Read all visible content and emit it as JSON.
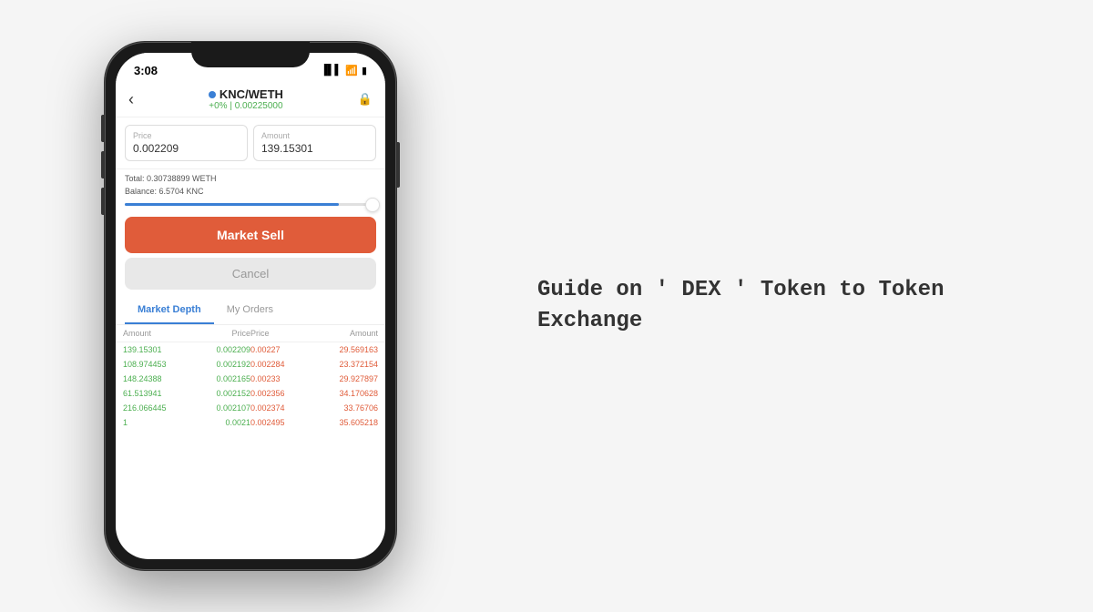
{
  "page": {
    "background": "#f5f5f5"
  },
  "status_bar": {
    "time": "3:08",
    "signal": "▐▌▌",
    "wifi": "WiFi",
    "battery": "🔋"
  },
  "header": {
    "back_label": "‹",
    "pair": "KNC/WETH",
    "change": "+0% | 0.00225000",
    "lock_icon": "🔒"
  },
  "price_input": {
    "label": "Price",
    "value": "0.002209"
  },
  "amount_input": {
    "label": "Amount",
    "value": "139.15301"
  },
  "total_info": {
    "total": "Total: 0.30738899 WETH",
    "balance": "Balance: 6.5704 KNC"
  },
  "buttons": {
    "sell": "Market Sell",
    "cancel": "Cancel"
  },
  "tabs": {
    "market_depth": "Market Depth",
    "my_orders": "My Orders"
  },
  "depth_header": {
    "amount_left": "Amount",
    "price_left": "Price",
    "price_right": "Price",
    "amount_right": "Amount"
  },
  "depth_rows": [
    {
      "amount_left": "139.15301",
      "price_left": "0.002209",
      "price_right": "0.00227",
      "amount_right": "29.569163"
    },
    {
      "amount_left": "108.974453",
      "price_left": "0.002192",
      "price_right": "0.002284",
      "amount_right": "23.372154"
    },
    {
      "amount_left": "148.24388",
      "price_left": "0.002165",
      "price_right": "0.00233",
      "amount_right": "29.927897"
    },
    {
      "amount_left": "61.513941",
      "price_left": "0.002152",
      "price_right": "0.002356",
      "amount_right": "34.170628"
    },
    {
      "amount_left": "216.066445",
      "price_left": "0.002107",
      "price_right": "0.002374",
      "amount_right": "33.76706"
    },
    {
      "amount_left": "1",
      "price_left": "0.0021",
      "price_right": "0.002495",
      "amount_right": "35.605218"
    }
  ],
  "guide": {
    "title": "Guide on ' DEX ' Token to Token Exchange"
  }
}
